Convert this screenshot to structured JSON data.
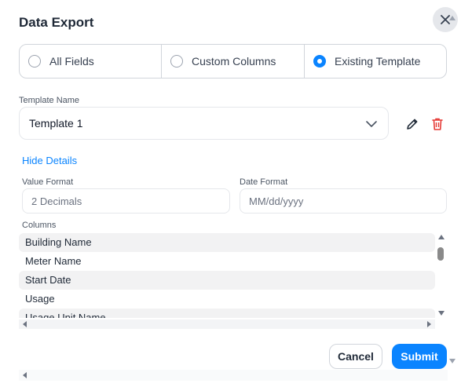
{
  "dialog": {
    "title": "Data Export",
    "close_icon": "close-icon"
  },
  "export_mode": {
    "options": [
      {
        "label": "All Fields",
        "selected": false
      },
      {
        "label": "Custom Columns",
        "selected": false
      },
      {
        "label": "Existing Template",
        "selected": true
      }
    ]
  },
  "template": {
    "label": "Template Name",
    "value": "Template 1",
    "edit_icon": "pencil-icon",
    "delete_icon": "trash-icon"
  },
  "details_toggle": "Hide Details",
  "value_format": {
    "label": "Value Format",
    "value": "2 Decimals"
  },
  "date_format": {
    "label": "Date Format",
    "value": "MM/dd/yyyy"
  },
  "columns": {
    "label": "Columns",
    "items": [
      "Building Name",
      "Meter Name",
      "Start Date",
      "Usage",
      "Usage Unit Name"
    ]
  },
  "actions": {
    "cancel": "Cancel",
    "submit": "Submit"
  },
  "colors": {
    "accent": "#0a84ff",
    "danger": "#e53935"
  }
}
